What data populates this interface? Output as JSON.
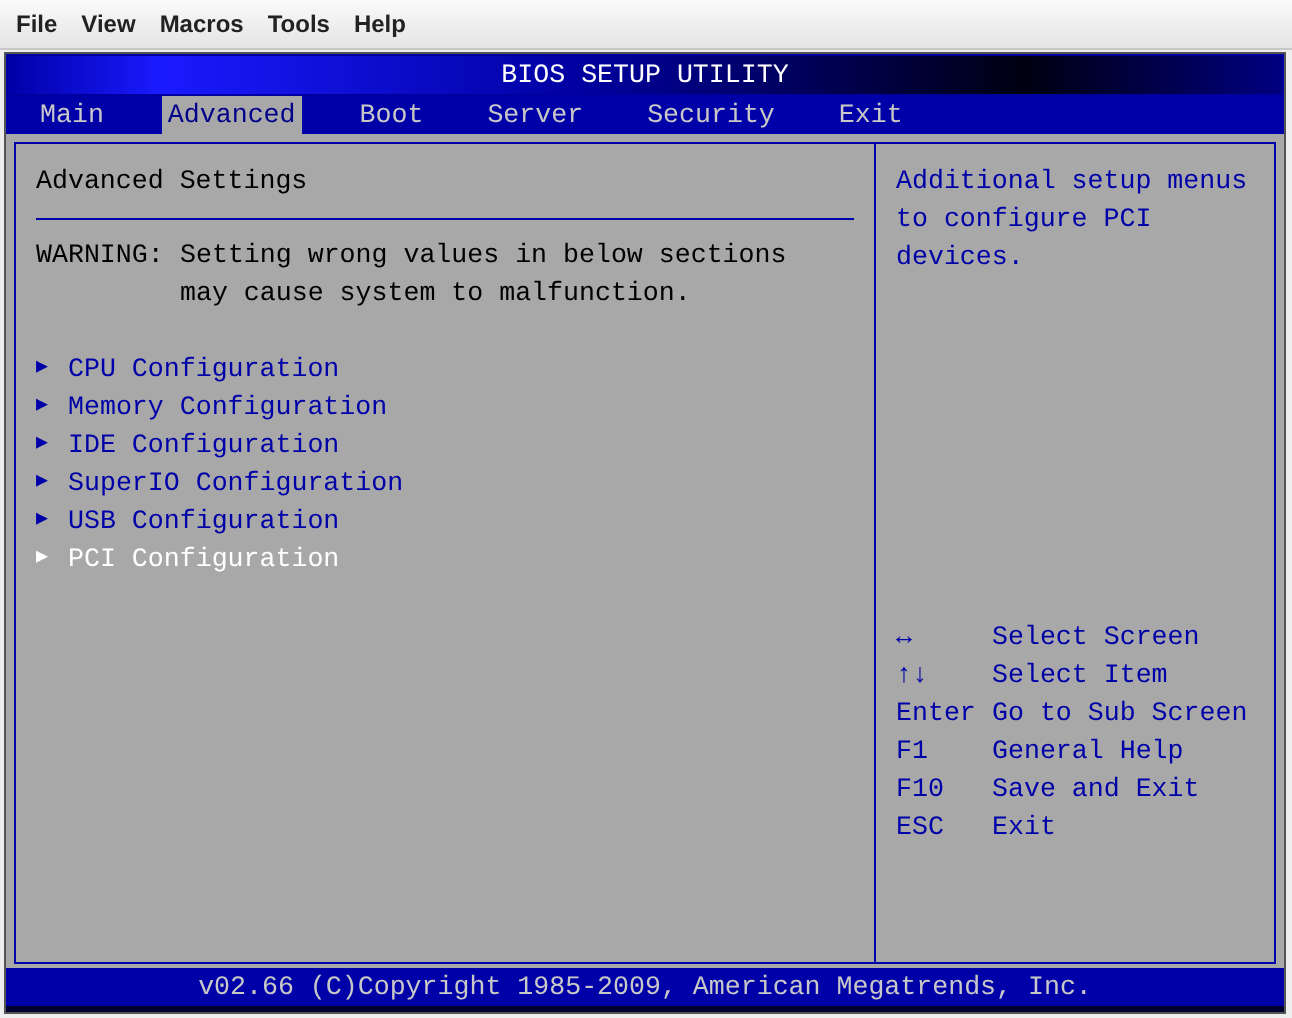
{
  "menubar": [
    "File",
    "View",
    "Macros",
    "Tools",
    "Help"
  ],
  "window": {
    "title": "BIOS SETUP UTILITY"
  },
  "tabs": [
    {
      "label": "Main",
      "selected": false
    },
    {
      "label": "Advanced",
      "selected": true
    },
    {
      "label": "Boot",
      "selected": false
    },
    {
      "label": "Server",
      "selected": false
    },
    {
      "label": "Security",
      "selected": false
    },
    {
      "label": "Exit",
      "selected": false
    }
  ],
  "panel": {
    "heading": "Advanced Settings",
    "warning_label": "WARNING:",
    "warning_lines": [
      "Setting wrong values in below sections",
      "may cause system to malfunction."
    ],
    "items": [
      {
        "arrow": "▶",
        "label": "CPU Configuration",
        "selected": false
      },
      {
        "arrow": "▶",
        "label": "Memory Configuration",
        "selected": false
      },
      {
        "arrow": "▶",
        "label": "IDE Configuration",
        "selected": false
      },
      {
        "arrow": "▶",
        "label": "SuperIO Configuration",
        "selected": false
      },
      {
        "arrow": "▶",
        "label": "USB Configuration",
        "selected": false
      },
      {
        "arrow": "▶",
        "label": "PCI Configuration",
        "selected": true
      }
    ]
  },
  "help": {
    "description": "Additional setup menus to configure PCI devices.",
    "keys": [
      {
        "key": "↔",
        "action": "Select Screen"
      },
      {
        "key": "↑↓",
        "action": "Select Item"
      },
      {
        "key": "Enter",
        "action": "Go to Sub Screen"
      },
      {
        "key": "F1",
        "action": "General Help"
      },
      {
        "key": "F10",
        "action": "Save and Exit"
      },
      {
        "key": "ESC",
        "action": "Exit"
      }
    ]
  },
  "status_bar": "v02.66 (C)Copyright 1985-2009, American Megatrends, Inc."
}
